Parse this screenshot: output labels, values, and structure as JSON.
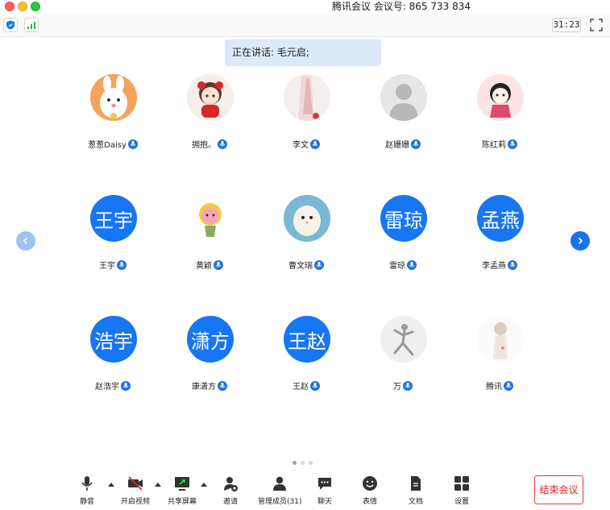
{
  "window": {
    "title": "腾讯会议 会议号: 865 733 834"
  },
  "topbar": {
    "timer": "31:23",
    "icons": [
      "shield-icon",
      "signal-icon",
      "fullscreen-icon"
    ]
  },
  "speaking": {
    "text": "正在讲话: 毛元启;"
  },
  "participants": [
    {
      "name": "葱葱Daisy",
      "avatar_type": "image",
      "initials": ""
    },
    {
      "name": "拥抱。",
      "avatar_type": "image",
      "initials": ""
    },
    {
      "name": "李文",
      "avatar_type": "image",
      "initials": ""
    },
    {
      "name": "赵姗姗",
      "avatar_type": "image",
      "initials": ""
    },
    {
      "name": "陈红莉",
      "avatar_type": "image",
      "initials": ""
    },
    {
      "name": "王宇",
      "avatar_type": "initials",
      "initials": "王宇"
    },
    {
      "name": "黄颖",
      "avatar_type": "image",
      "initials": ""
    },
    {
      "name": "曹文瑞",
      "avatar_type": "image",
      "initials": ""
    },
    {
      "name": "雷琼",
      "avatar_type": "initials",
      "initials": "雷琼"
    },
    {
      "name": "李孟燕",
      "avatar_type": "initials",
      "initials": "孟燕"
    },
    {
      "name": "赵浩宇",
      "avatar_type": "initials",
      "initials": "浩宇"
    },
    {
      "name": "康潇方",
      "avatar_type": "initials",
      "initials": "潇方"
    },
    {
      "name": "王赵",
      "avatar_type": "initials",
      "initials": "王赵"
    },
    {
      "name": "万",
      "avatar_type": "image",
      "initials": ""
    },
    {
      "name": "腾讯",
      "avatar_type": "image",
      "initials": ""
    }
  ],
  "pager": {
    "total_pages": 3,
    "current_page": 1
  },
  "bottombar": {
    "mute_label": "静音",
    "video_label": "开启视频",
    "share_label": "共享屏幕",
    "invite_label": "邀请",
    "members_label": "管理成员(31)",
    "chat_label": "聊天",
    "reactions_label": "表情",
    "docs_label": "文档",
    "settings_label": "设置",
    "end_label": "结束会议"
  },
  "colors": {
    "accent": "#1676f3",
    "end": "#d92626",
    "banner": "#dce9f7"
  }
}
